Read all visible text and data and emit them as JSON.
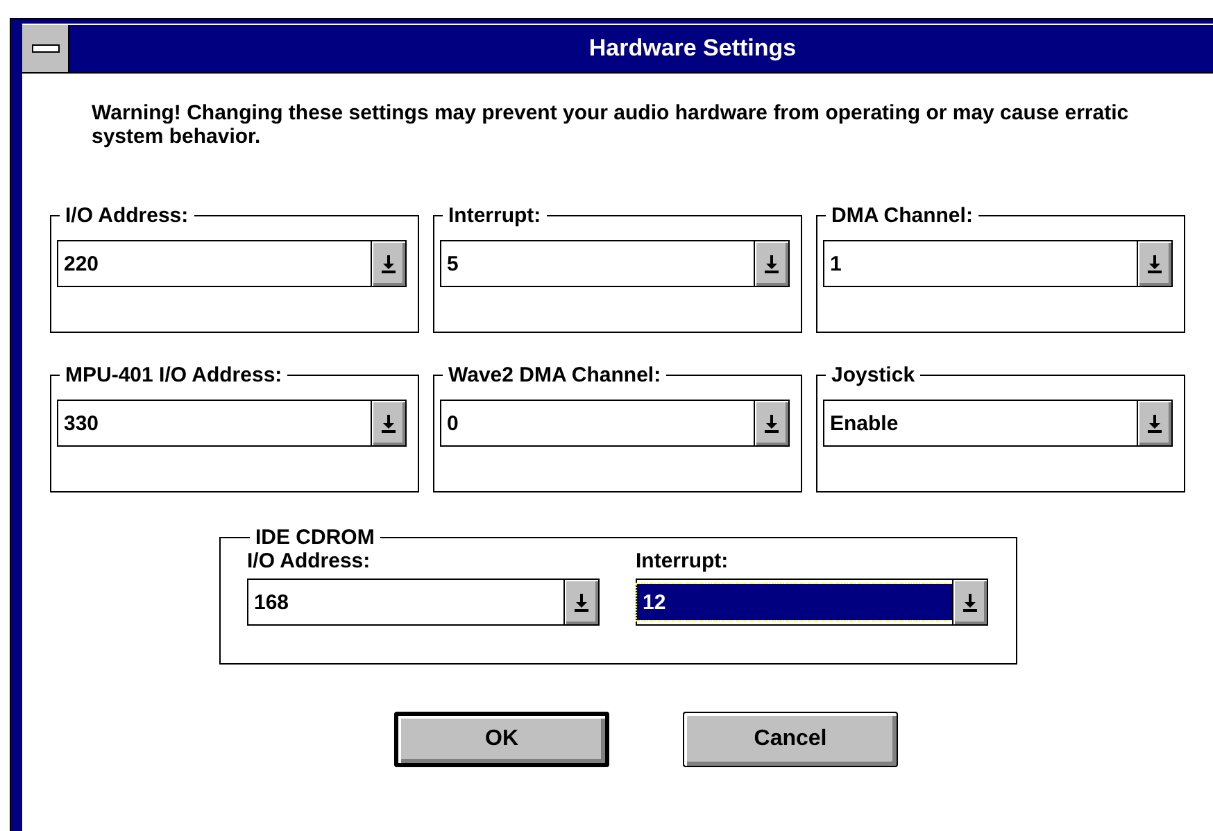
{
  "window": {
    "title": "Hardware Settings"
  },
  "warning": "Warning!  Changing these settings may prevent your audio hardware from operating or may cause erratic system behavior.",
  "groups": [
    {
      "label": "I/O Address:",
      "value": "220",
      "selected": false
    },
    {
      "label": "Interrupt:",
      "value": "5",
      "selected": false
    },
    {
      "label": "DMA Channel:",
      "value": "1",
      "selected": false
    },
    {
      "label": "MPU-401 I/O Address:",
      "value": "330",
      "selected": false
    },
    {
      "label": "Wave2 DMA Channel:",
      "value": "0",
      "selected": false
    },
    {
      "label": "Joystick",
      "value": "Enable",
      "selected": false
    }
  ],
  "ide_cdrom": {
    "label": "IDE CDROM",
    "fields": [
      {
        "label": "I/O Address:",
        "value": "168",
        "selected": false
      },
      {
        "label": "Interrupt:",
        "value": "12",
        "selected": true
      }
    ]
  },
  "buttons": [
    {
      "label": "OK",
      "default": true
    },
    {
      "label": "Cancel",
      "default": false
    }
  ]
}
